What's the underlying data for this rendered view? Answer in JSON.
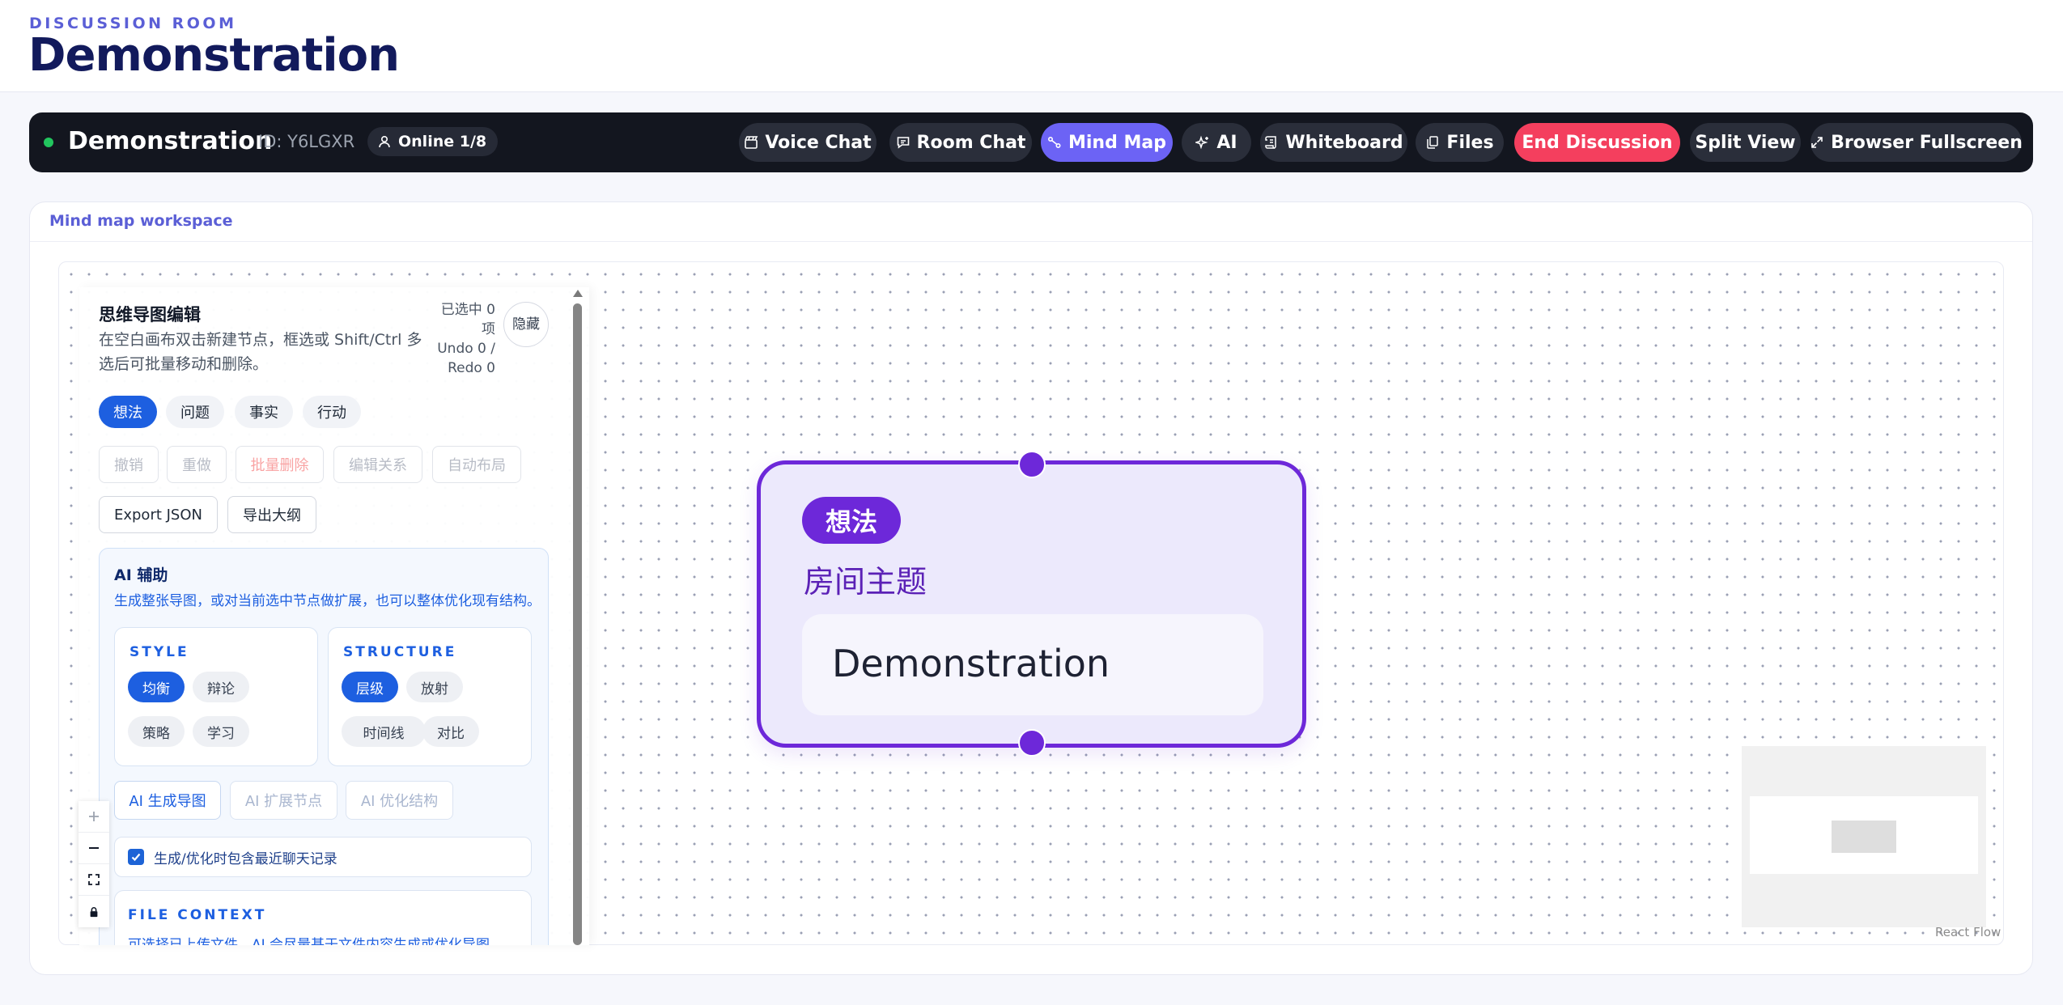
{
  "header": {
    "eyebrow": "DISCUSSION ROOM",
    "title": "Demonstration"
  },
  "roombar": {
    "room_name": "Demonstration",
    "room_id": "ID: Y6LGXR",
    "online": "Online 1/8",
    "buttons": {
      "voice_chat": "Voice Chat",
      "room_chat": "Room Chat",
      "mind_map": "Mind Map",
      "ai": "AI",
      "whiteboard": "Whiteboard",
      "files": "Files",
      "end_discussion": "End Discussion",
      "split_view": "Split View",
      "browser_fullscreen": "Browser Fullscreen"
    },
    "active": "mind_map",
    "colors": {
      "active": "#6c63f5",
      "danger": "#f43f5e",
      "online": "#22c55e"
    }
  },
  "workspace": {
    "title": "Mind map workspace"
  },
  "editor": {
    "title": "思维导图编辑",
    "description": "在空白画布双击新建节点，框选或 Shift/Ctrl 多选后可批量移动和删除。",
    "meta_selected": "已选中 0 项",
    "meta_history": "Undo 0 / Redo 0",
    "hide_button": "隐藏",
    "node_types": [
      "想法",
      "问题",
      "事实",
      "行动"
    ],
    "selected_type": "想法",
    "actions": {
      "undo": "撤销",
      "redo": "重做",
      "batch_delete": "批量删除",
      "edit_relation": "编辑关系",
      "auto_layout": "自动布局",
      "export_json": "Export JSON",
      "export_outline": "导出大纲"
    },
    "ai": {
      "title": "AI 辅助",
      "description": "生成整张导图，或对当前选中节点做扩展，也可以整体优化现有结构。",
      "style_label": "STYLE",
      "styles": [
        "均衡",
        "辩论",
        "策略",
        "学习"
      ],
      "selected_style": "均衡",
      "structure_label": "STRUCTURE",
      "structures": [
        "层级",
        "放射",
        "时间线",
        "对比"
      ],
      "selected_structure": "层级",
      "generate": "AI 生成导图",
      "expand": "AI 扩展节点",
      "optimize": "AI 优化结构",
      "include_chat": "生成/优化时包含最近聊天记录",
      "include_chat_checked": true,
      "file_context_label": "FILE CONTEXT",
      "file_context_desc": "可选择已上传文件，AI 会尽量基于文件内容生成或优化导图。"
    }
  },
  "canvas": {
    "node": {
      "tag": "想法",
      "subtitle": "房间主题",
      "text": "Demonstration",
      "color": "#6d28d9"
    },
    "zoom_controls": [
      "zoom-in",
      "zoom-out",
      "fit-view",
      "lock"
    ],
    "attribution": "React Flow"
  }
}
